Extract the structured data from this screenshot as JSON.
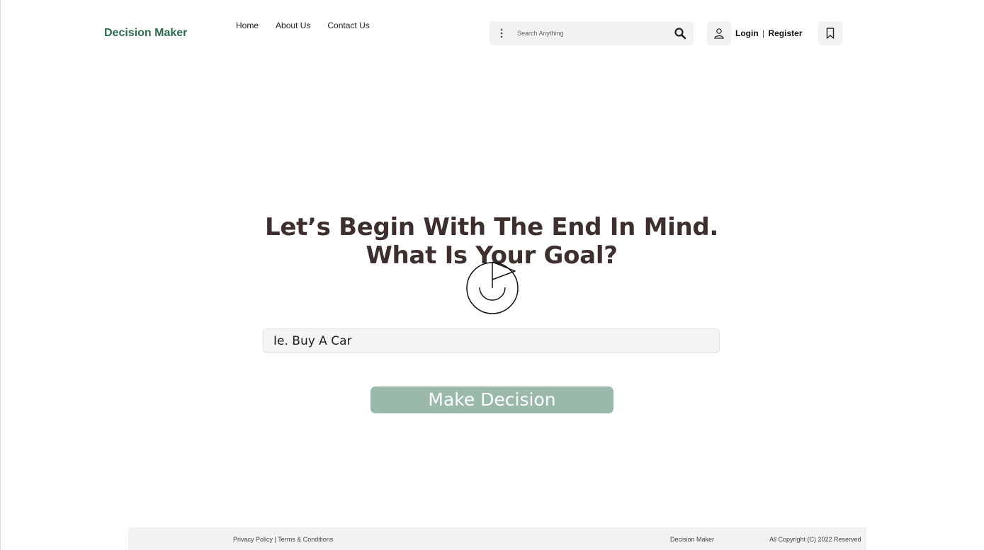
{
  "header": {
    "logo": "Decision Maker",
    "nav": [
      "Home",
      "About Us",
      "Contact Us"
    ],
    "search": {
      "placeholder": "Search Anything"
    },
    "auth": {
      "login": "Login",
      "separator": "|",
      "register": "Register"
    }
  },
  "main": {
    "headline": "Let’s Begin With The End In Mind. What Is Your Goal?",
    "goal_input": {
      "placeholder": "Ie. Buy A Car"
    },
    "submit_label": "Make Decision"
  },
  "footer": {
    "privacy": "Privacy Policy",
    "separator": " | ",
    "terms": "Terms & Conditions",
    "brand": "Decision Maker",
    "copyright": "All Copyright (C) 2022 Reserved"
  },
  "colors": {
    "brand": "#2f6b4f",
    "button": "#9ab9ab",
    "headline": "#3e2f2f"
  },
  "icons": [
    "kebab-menu-icon",
    "search-icon",
    "user-icon",
    "bookmark-icon",
    "goal-flag-icon"
  ]
}
